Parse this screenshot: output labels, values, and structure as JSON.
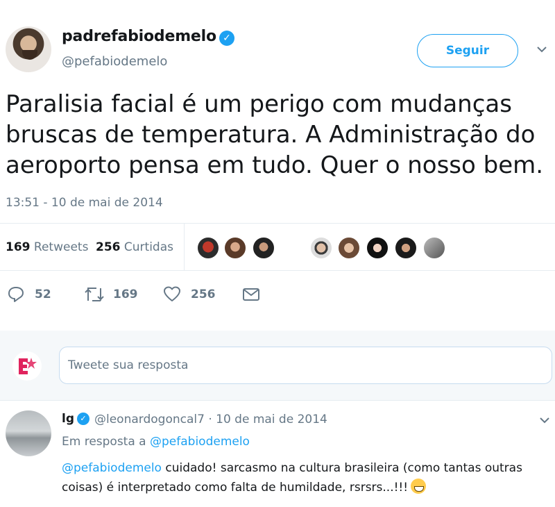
{
  "tweet": {
    "author_name": "padrefabiodemelo",
    "author_handle": "@pefabiodemelo",
    "follow_label": "Seguir",
    "text": "Paralisia facial é um perigo com mudanças bruscas de temperatura. A Administração do aeroporto pensa em tudo. Quer o nosso bem.",
    "timestamp": "13:51 - 10 de mai de 2014",
    "retweets_count": "169",
    "retweets_label": "Retweets",
    "likes_count": "256",
    "likes_label": "Curtidas",
    "actions": {
      "reply_count": "52",
      "retweet_count": "169",
      "like_count": "256"
    }
  },
  "composer": {
    "placeholder": "Tweete sua resposta"
  },
  "reply": {
    "name": "lg",
    "handle_date": "@leonardogoncal7 · 10 de mai de 2014",
    "in_reply_prefix": "Em resposta a ",
    "in_reply_handle": "@pefabiodemelo",
    "mention": "@pefabiodemelo",
    "body": " cuidado! sarcasmo na cultura brasileira (como tantas outras coisas) é interpretado como falta de humildade, rsrsrs...!!!"
  },
  "colors": {
    "accent": "#1da1f2",
    "muted": "#657786",
    "text": "#14171a"
  },
  "icons": [
    "verified-badge-icon",
    "chevron-down-icon",
    "reply-icon",
    "retweet-icon",
    "heart-icon",
    "message-icon",
    "grinning-emoji-icon"
  ]
}
